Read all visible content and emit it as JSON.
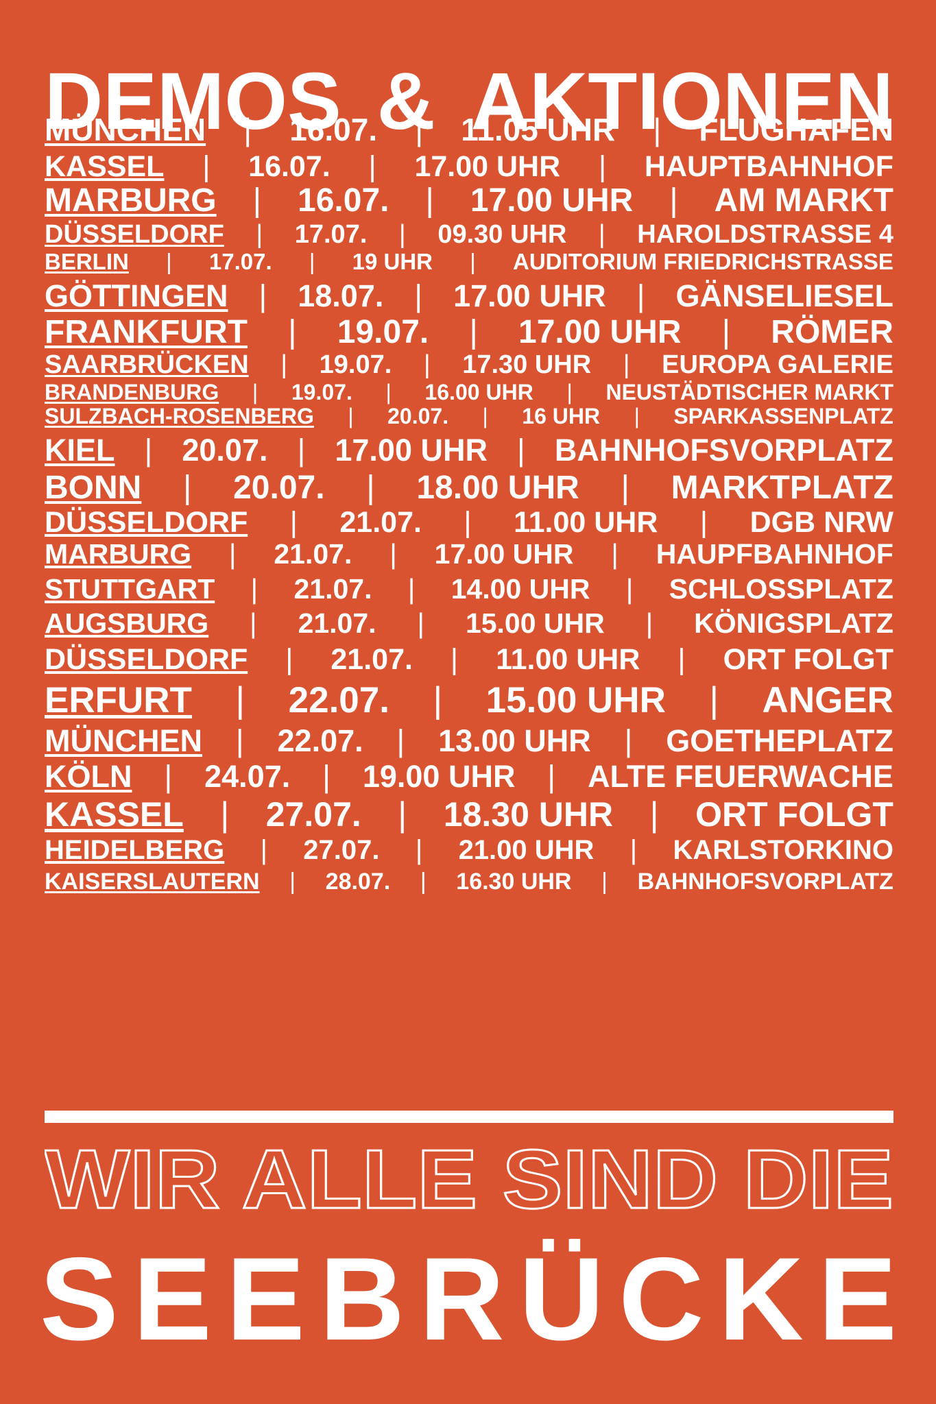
{
  "title": [
    "DEMOS",
    "&",
    "AKTIONEN"
  ],
  "events": [
    {
      "city": "MÜNCHEN",
      "date": "16.07.",
      "time": "11.05 UHR",
      "place": "FLUGHAFEN"
    },
    {
      "city": "KASSEL",
      "date": "16.07.",
      "time": "17.00 UHR",
      "place": "HAUPTBAHNHOF"
    },
    {
      "city": "MARBURG",
      "date": "16.07.",
      "time": "17.00 UHR",
      "place": "AM MARKT"
    },
    {
      "city": "DÜSSELDORF",
      "date": "17.07.",
      "time": "09.30 UHR",
      "place": "HAROLDSTRASSE 4"
    },
    {
      "city": "BERLIN",
      "date": "17.07.",
      "time": "19 UHR",
      "place": "AUDITORIUM FRIEDRICHSTRASSE"
    },
    {
      "city": "GÖTTINGEN",
      "date": "18.07.",
      "time": "17.00 UHR",
      "place": "GÄNSELIESEL"
    },
    {
      "city": "FRANKFURT",
      "date": "19.07.",
      "time": "17.00 UHR",
      "place": "RÖMER"
    },
    {
      "city": "SAARBRÜCKEN",
      "date": "19.07.",
      "time": "17.30 UHR",
      "place": "EUROPA GALERIE"
    },
    {
      "city": "BRANDENBURG",
      "date": "19.07.",
      "time": "16.00 UHR",
      "place": "NEUSTÄDTISCHER MARKT"
    },
    {
      "city": "SULZBACH-ROSENBERG",
      "date": "20.07.",
      "time": "16 UHR",
      "place": "SPARKASSENPLATZ"
    },
    {
      "city": "KIEL",
      "date": "20.07.",
      "time": "17.00 UHR",
      "place": "BAHNHOFSVORPLATZ"
    },
    {
      "city": "BONN",
      "date": "20.07.",
      "time": "18.00 UHR",
      "place": "MARKTPLATZ"
    },
    {
      "city": "DÜSSELDORF",
      "date": "21.07.",
      "time": "11.00 UHR",
      "place": "DGB NRW"
    },
    {
      "city": "MARBURG",
      "date": "21.07.",
      "time": "17.00 UHR",
      "place": "HAUPFBAHNHOF"
    },
    {
      "city": "STUTTGART",
      "date": "21.07.",
      "time": "14.00 UHR",
      "place": "SCHLOSSPLATZ"
    },
    {
      "city": "AUGSBURG",
      "date": "21.07.",
      "time": "15.00 UHR",
      "place": "KÖNIGSPLATZ"
    },
    {
      "city": "DÜSSELDORF",
      "date": "21.07.",
      "time": "11.00 UHR",
      "place": "ORT FOLGT"
    },
    {
      "city": "ERFURT",
      "date": "22.07.",
      "time": "15.00 UHR",
      "place": "ANGER"
    },
    {
      "city": "MÜNCHEN",
      "date": "22.07.",
      "time": "13.00 UHR",
      "place": "GOETHEPLATZ"
    },
    {
      "city": "KÖLN",
      "date": "24.07.",
      "time": "19.00 UHR",
      "place": "ALTE FEUERWACHE"
    },
    {
      "city": "KASSEL",
      "date": "27.07.",
      "time": "18.30 UHR",
      "place": "ORT FOLGT"
    },
    {
      "city": "HEIDELBERG",
      "date": "27.07.",
      "time": "21.00 UHR",
      "place": "KARLSTORKINO"
    },
    {
      "city": "KAISERSLAUTERN",
      "date": "28.07.",
      "time": "16.30 UHR",
      "place": "BAHNHOFSVORPLATZ"
    }
  ],
  "separator": "|",
  "slogan_outline": "WIR ALLE SIND DIE",
  "slogan_main": "SEEBRÜCKE",
  "colors": {
    "background": "#d95330",
    "text": "#ffffff"
  }
}
